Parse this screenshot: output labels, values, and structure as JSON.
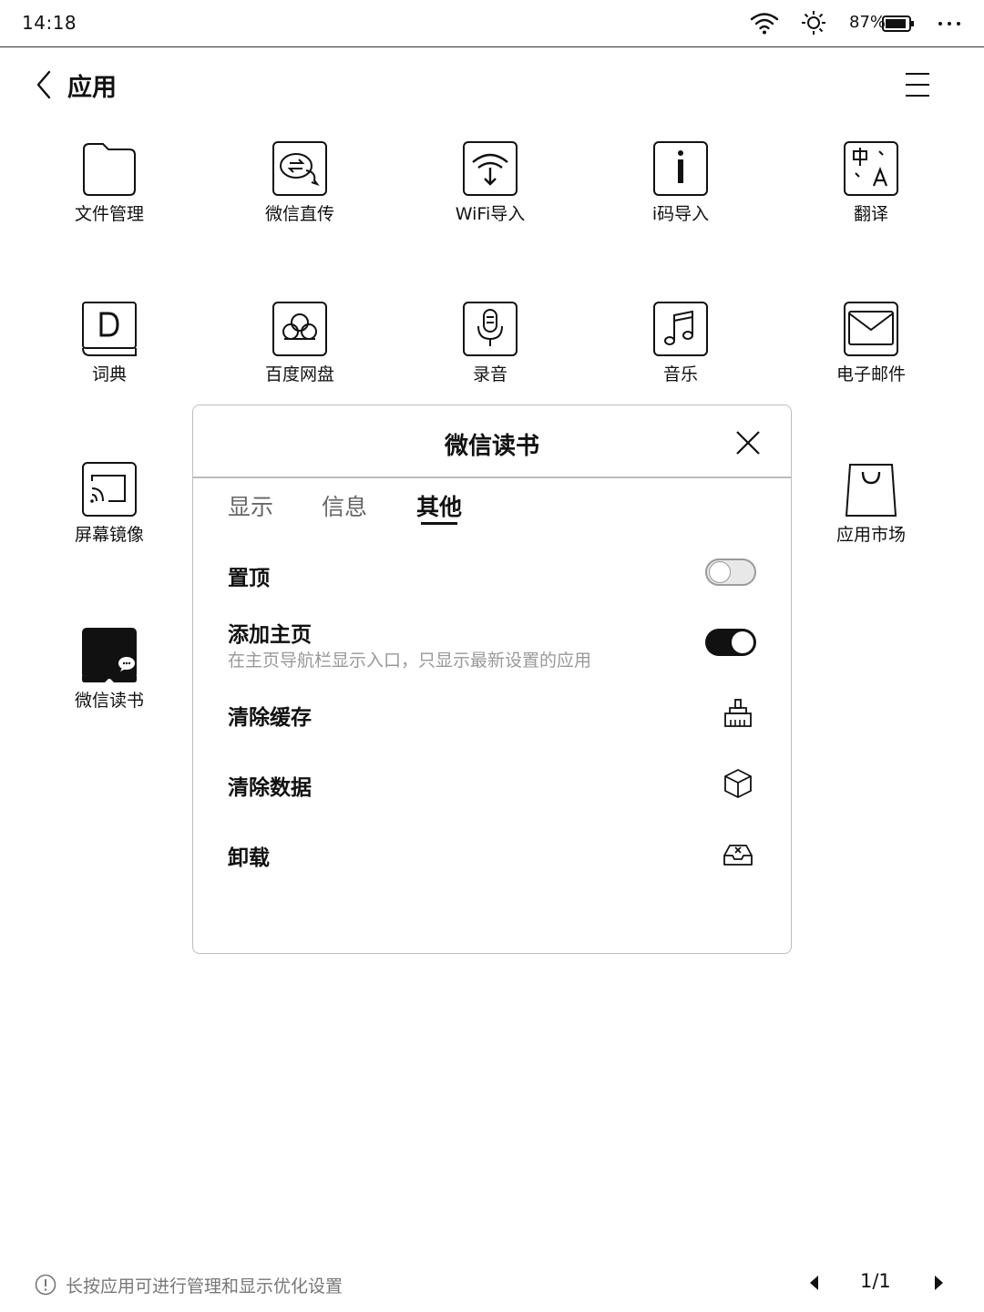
{
  "status_bar": {
    "time": "14:18",
    "battery": "87%"
  },
  "header": {
    "title": "应用",
    "back_icon": "chevron-left-icon",
    "menu_icon": "hamburger-menu-icon"
  },
  "apps": [
    {
      "label": "文件管理",
      "icon": "folder-icon"
    },
    {
      "label": "微信直传",
      "icon": "wechat-transfer-icon"
    },
    {
      "label": "WiFi导入",
      "icon": "wifi-import-icon"
    },
    {
      "label": "i码导入",
      "icon": "i-code-icon"
    },
    {
      "label": "翻译",
      "icon": "translate-icon"
    },
    {
      "label": "词典",
      "icon": "dictionary-icon"
    },
    {
      "label": "百度网盘",
      "icon": "baidu-cloud-icon"
    },
    {
      "label": "录音",
      "icon": "microphone-icon"
    },
    {
      "label": "音乐",
      "icon": "music-icon"
    },
    {
      "label": "电子邮件",
      "icon": "mail-icon"
    },
    {
      "label": "屏幕镜像",
      "icon": "screen-cast-icon"
    },
    {
      "label": "应用市场",
      "icon": "shopping-bag-icon"
    },
    {
      "label": "微信读书",
      "icon": "wechat-read-icon"
    }
  ],
  "dialog": {
    "title": "微信读书",
    "tabs": [
      {
        "label": "显示",
        "active": false
      },
      {
        "label": "信息",
        "active": false
      },
      {
        "label": "其他",
        "active": true
      }
    ],
    "rows": {
      "pin": {
        "label": "置顶",
        "toggle_on": false
      },
      "add_home": {
        "label": "添加主页",
        "sub": "在主页导航栏显示入口，只显示最新设置的应用",
        "toggle_on": true
      },
      "clear_cache": {
        "label": "清除缓存",
        "icon": "broom-icon"
      },
      "clear_data": {
        "label": "清除数据",
        "icon": "cube-icon"
      },
      "uninstall": {
        "label": "卸载",
        "icon": "uninstall-tray-icon"
      }
    }
  },
  "footer": {
    "hint": "长按应用可进行管理和显示优化设置",
    "page": "1/1"
  }
}
